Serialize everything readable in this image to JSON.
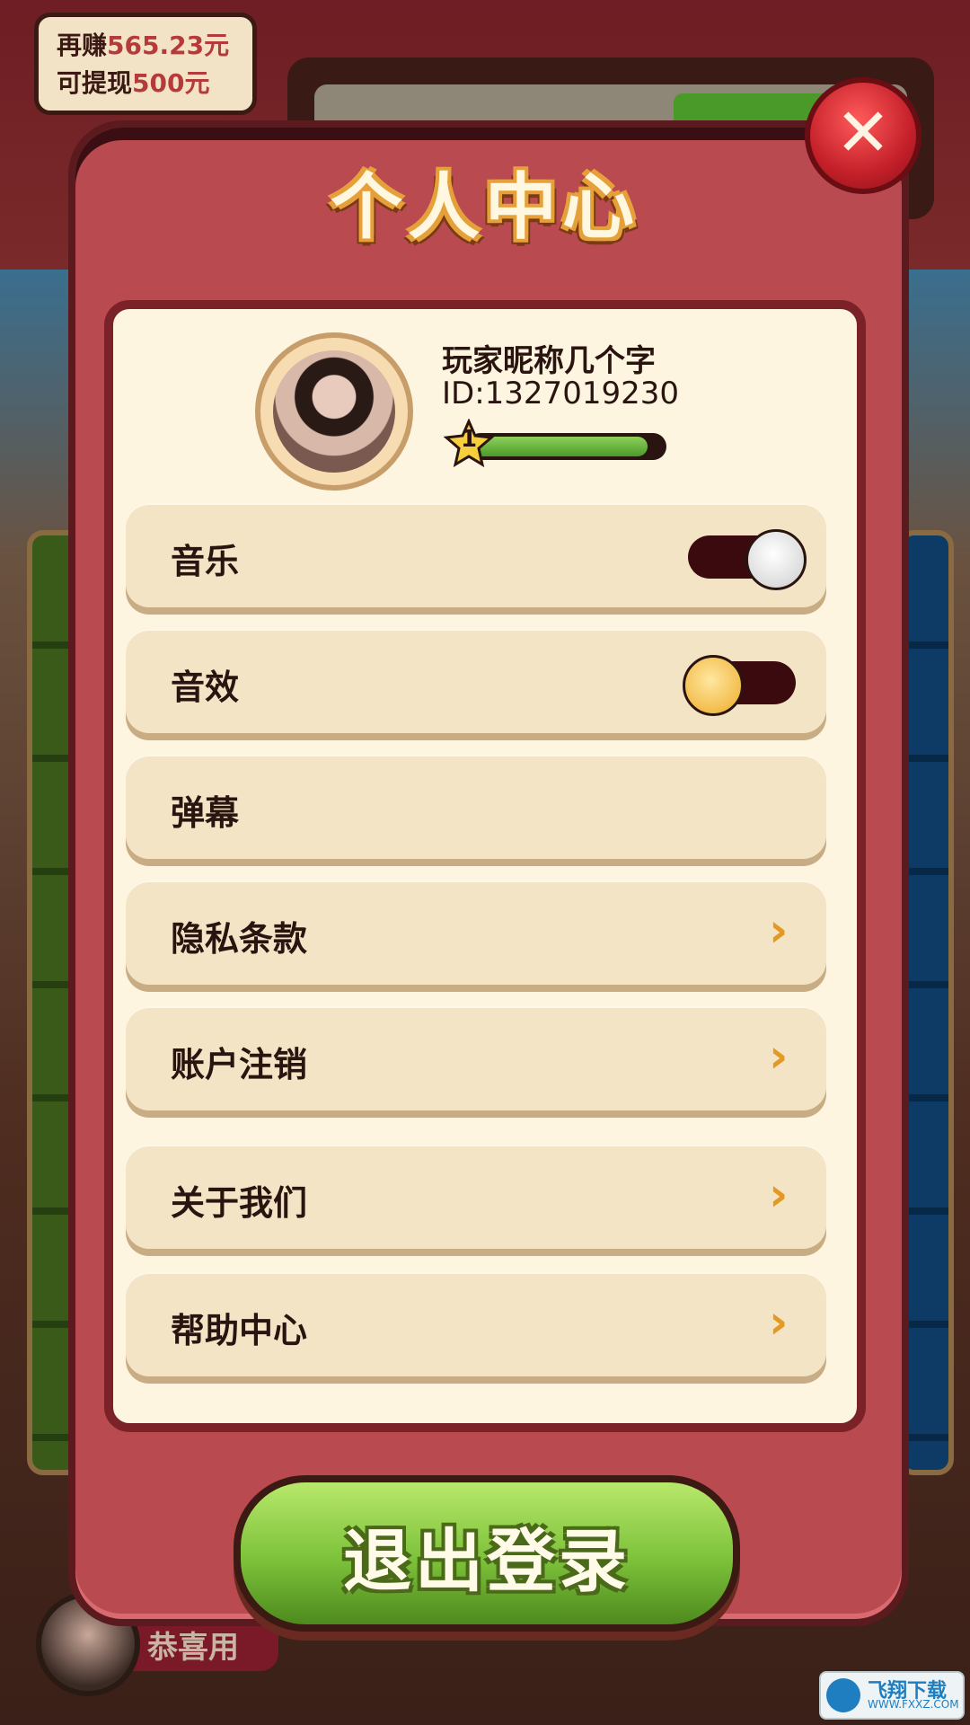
{
  "hud": {
    "earn_prefix": "再赚",
    "earn_amount": "565.23元",
    "withdraw_prefix": "可提现",
    "withdraw_amount": "500元"
  },
  "modal": {
    "title": "个人中心",
    "close_glyph": "✕"
  },
  "profile": {
    "nickname": "玩家昵称几个字",
    "id_text": "ID:1327019230",
    "level": "1",
    "level_progress": 0.92
  },
  "settings": [
    {
      "label": "音乐",
      "type": "toggle",
      "on": true
    },
    {
      "label": "音效",
      "type": "toggle",
      "on": false
    },
    {
      "label": "弹幕",
      "type": "plain"
    },
    {
      "label": "隐私条款",
      "type": "link"
    },
    {
      "label": "账户注销",
      "type": "link"
    },
    {
      "label": "关于我们",
      "type": "link"
    },
    {
      "label": "帮助中心",
      "type": "link"
    }
  ],
  "chevron_glyph": "›",
  "logout_label": "退出登录",
  "bottom_banner": {
    "text": "恭喜用"
  },
  "watermark": {
    "name": "飞翔下载",
    "url": "WWW.FXXZ.COM"
  },
  "colors": {
    "accent_green": "#7cc13a",
    "modal_red": "#b84a50",
    "chevron": "#e39a24"
  }
}
